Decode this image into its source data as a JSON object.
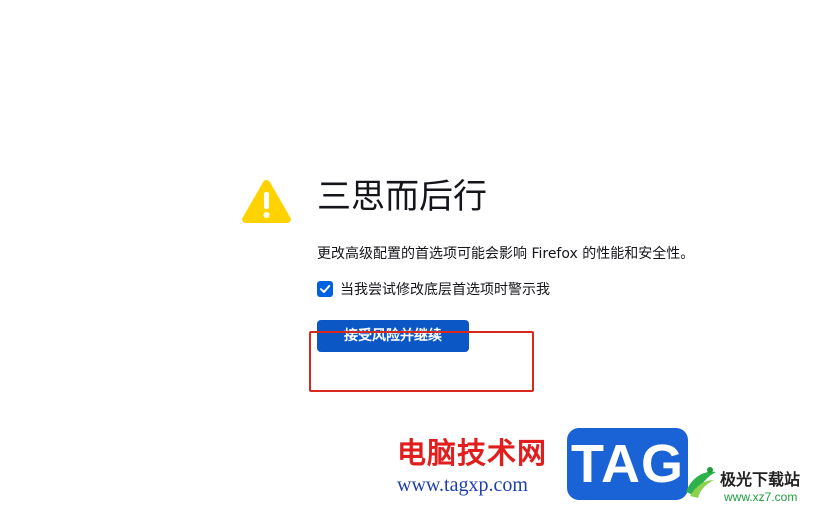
{
  "warning": {
    "icon": "warning-icon",
    "title": "三思而后行",
    "description": "更改高级配置的首选项可能会影响 Firefox 的性能和安全性。",
    "checkbox_label": "当我尝试修改底层首选项时警示我",
    "checkbox_checked": true,
    "accept_button": "接受风险并继续"
  },
  "colors": {
    "warning_yellow": "#ffd200",
    "accent_blue": "#0060df",
    "button_blue": "#0b57c5",
    "highlight_red": "#d9281e"
  },
  "watermark": {
    "site_name_cn": "电脑技术网",
    "site_url": "www.tagxp.com",
    "tag_logo": "TAG",
    "download_site": "极光下载站",
    "download_url": "www.xz7.com"
  }
}
